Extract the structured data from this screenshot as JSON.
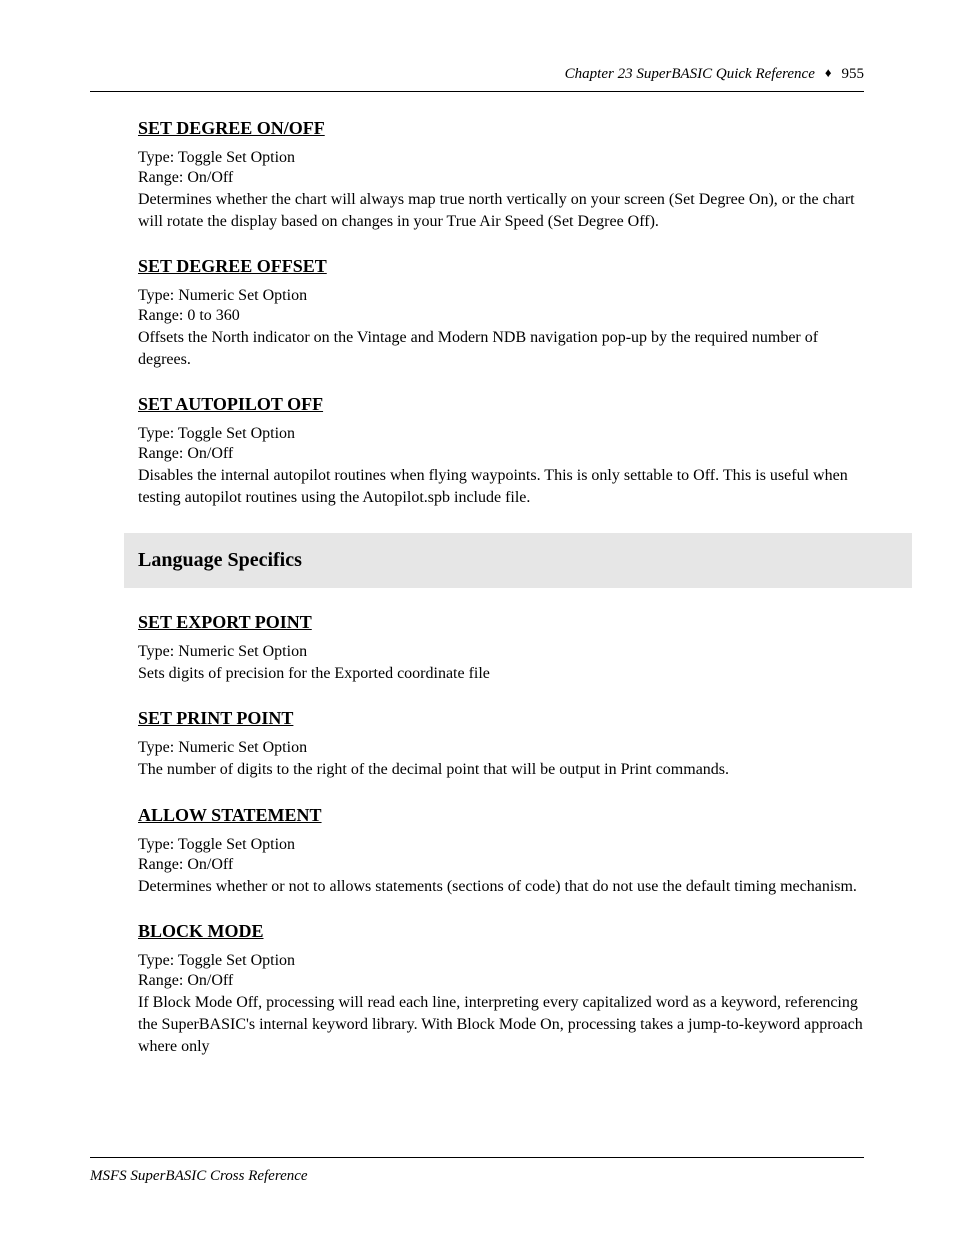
{
  "header": {
    "title": "Chapter 23    SuperBASIC Quick Reference",
    "page_number": "955"
  },
  "entries_top": [
    {
      "term": "SET DEGREE ON/OFF",
      "type": "Type: Toggle Set Option",
      "range": "Range: On/Off",
      "desc": "Determines whether the chart will always map true north vertically on your screen (Set Degree On), or the chart will rotate the display based on changes in your True Air Speed (Set Degree Off)."
    },
    {
      "term": "SET DEGREE OFFSET",
      "type": "Type: Numeric Set Option",
      "range": "Range: 0 to 360",
      "desc": "Offsets the North indicator on the Vintage and Modern NDB navigation pop-up by the required number of degrees."
    },
    {
      "term": "SET AUTOPILOT OFF",
      "type": "Type: Toggle Set Option",
      "range": "Range: On/Off",
      "desc": "Disables the internal autopilot routines when flying waypoints. This is only settable to Off.  This is useful when testing autopilot routines using the Autopilot.spb include file."
    }
  ],
  "section": {
    "title": "Language Specifics"
  },
  "entries_bottom": [
    {
      "term": "SET EXPORT POINT",
      "type": "Type: Numeric Set Option",
      "desc": "Sets digits of precision for the Exported coordinate file"
    },
    {
      "term": "SET PRINT POINT",
      "type": "Type: Numeric Set Option",
      "desc": "The number of digits to the right of the decimal point that will be output in Print commands."
    },
    {
      "term": "ALLOW STATEMENT",
      "type": "Type: Toggle Set Option",
      "range": "Range: On/Off",
      "desc": "Determines whether or not to allows statements (sections of code) that do not use the default timing mechanism."
    },
    {
      "term": "BLOCK MODE",
      "type": "Type: Toggle Set Option",
      "range": "Range: On/Off",
      "desc": "If Block Mode Off, processing will read each line, interpreting every capitalized word as a keyword, referencing the SuperBASIC's internal keyword library. With Block Mode On, processing takes a jump-to-keyword approach where only"
    }
  ],
  "footer": {
    "text": "MSFS SuperBASIC Cross Reference"
  }
}
